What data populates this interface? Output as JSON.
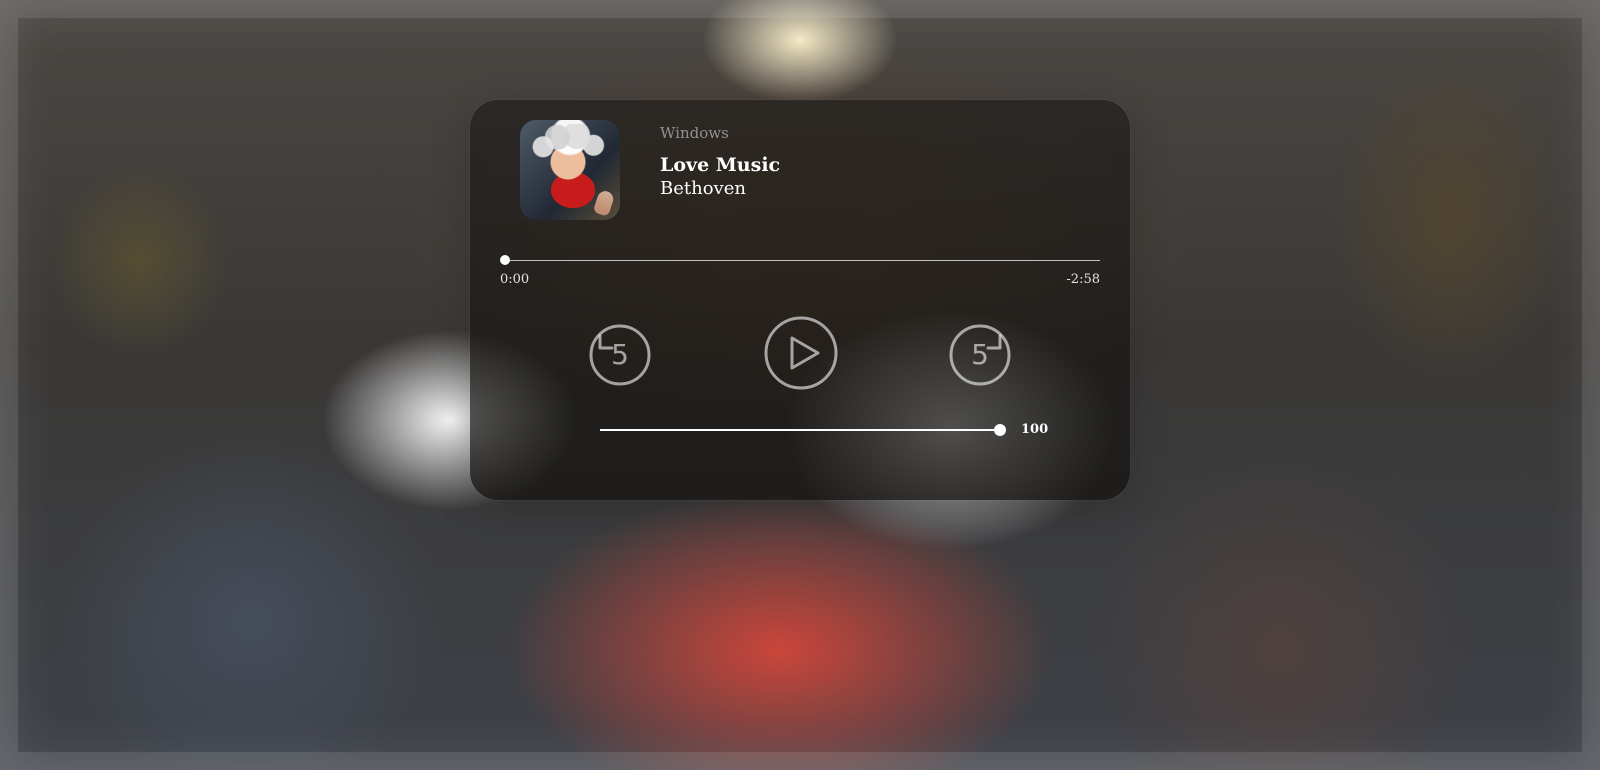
{
  "player": {
    "source": "Windows",
    "track_title": "Love Music",
    "artist": "Bethoven",
    "cover_art_icon": "album-art",
    "progress": {
      "current_time": "0:00",
      "remaining_time": "-2:58",
      "fraction": 0
    },
    "controls": {
      "back_label": "5",
      "forward_label": "5",
      "play_icon": "play-icon",
      "back_icon": "replay-5-icon",
      "forward_icon": "forward-5-icon"
    },
    "volume": {
      "value": "100",
      "fraction": 1
    }
  },
  "colors": {
    "card": "#1d1c19",
    "text_primary": "#ffffff",
    "text_secondary": "#9a9894",
    "control": "#bdbdbd"
  }
}
